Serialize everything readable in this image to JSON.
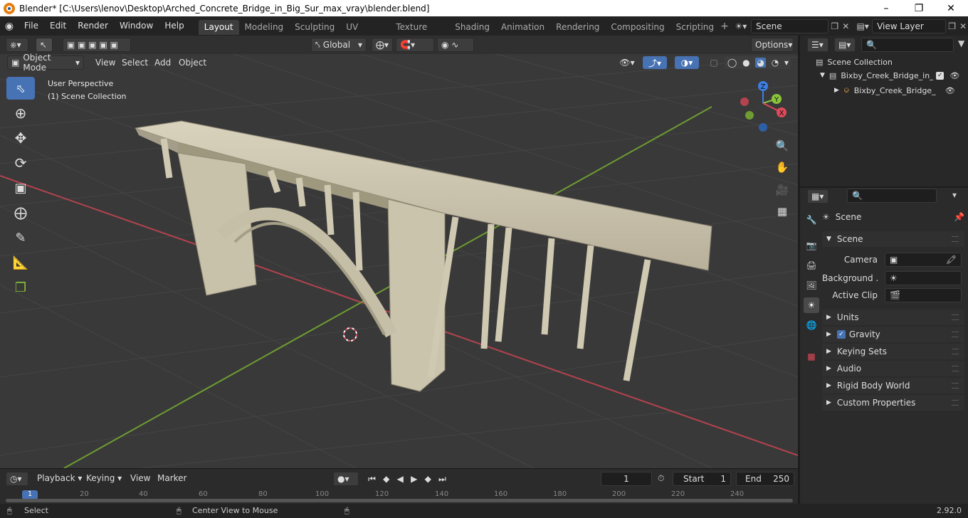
{
  "window": {
    "title": "Blender* [C:\\Users\\lenov\\Desktop\\Arched_Concrete_Bridge_in_Big_Sur_max_vray\\blender.blend]"
  },
  "menus": [
    "File",
    "Edit",
    "Render",
    "Window",
    "Help"
  ],
  "workspaces": [
    "Layout",
    "Modeling",
    "Sculpting",
    "UV Editing",
    "Texture Paint",
    "Shading",
    "Animation",
    "Rendering",
    "Compositing",
    "Scripting"
  ],
  "scene_field": "Scene",
  "view_layer_field": "View Layer",
  "viewport": {
    "transform_orientation": "Global",
    "options_label": "Options",
    "mode": "Object Mode",
    "header_menus": [
      "View",
      "Select",
      "Add",
      "Object"
    ],
    "info_line1": "User Perspective",
    "info_line2": "(1) Scene Collection",
    "gizmo_axes": {
      "z": "Z",
      "y": "Y",
      "x": "X"
    }
  },
  "outliner": {
    "root": "Scene Collection",
    "collection": "Bixby_Creek_Bridge_in_B",
    "object": "Bixby_Creek_Bridge_"
  },
  "properties": {
    "context_name": "Scene",
    "panel_title": "Scene",
    "camera_label": "Camera",
    "background_label": "Background ...",
    "active_clip_label": "Active Clip",
    "subpanels": [
      "Units",
      "Gravity",
      "Keying Sets",
      "Audio",
      "Rigid Body World",
      "Custom Properties"
    ],
    "gravity_checked": true
  },
  "timeline": {
    "menus": [
      "Playback",
      "Keying",
      "View",
      "Marker"
    ],
    "current_frame": "1",
    "start_label": "Start",
    "start_value": "1",
    "end_label": "End",
    "end_value": "250",
    "ruler_marks": [
      "1",
      "20",
      "40",
      "60",
      "80",
      "100",
      "120",
      "140",
      "160",
      "180",
      "200",
      "220",
      "240"
    ]
  },
  "status": {
    "left": "Select",
    "middle": "Center View to Mouse",
    "version": "2.92.0"
  },
  "colors": {
    "accent": "#4772b3",
    "x_axis": "#e04a5a",
    "y_axis": "#8ac43b",
    "z_axis": "#3d7ee0"
  }
}
